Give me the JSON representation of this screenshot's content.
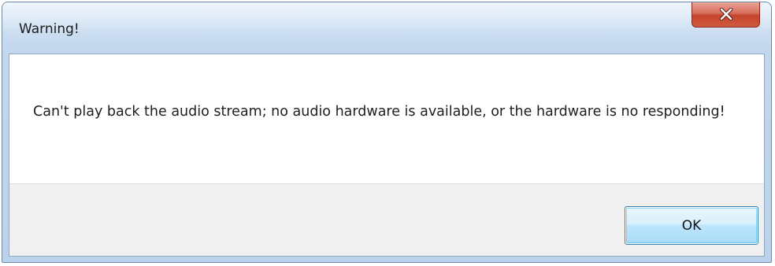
{
  "dialog": {
    "title": "Warning!",
    "message": "Can't play back the audio stream; no audio hardware is available, or the hardware is no responding!",
    "close_icon": "close-x-icon",
    "ok_label": "OK"
  },
  "colors": {
    "titlebar": "#cfe0f2",
    "close_button": "#c6442c",
    "button_bar": "#f0f0f0",
    "ok_button_border": "#3c7fb1"
  }
}
